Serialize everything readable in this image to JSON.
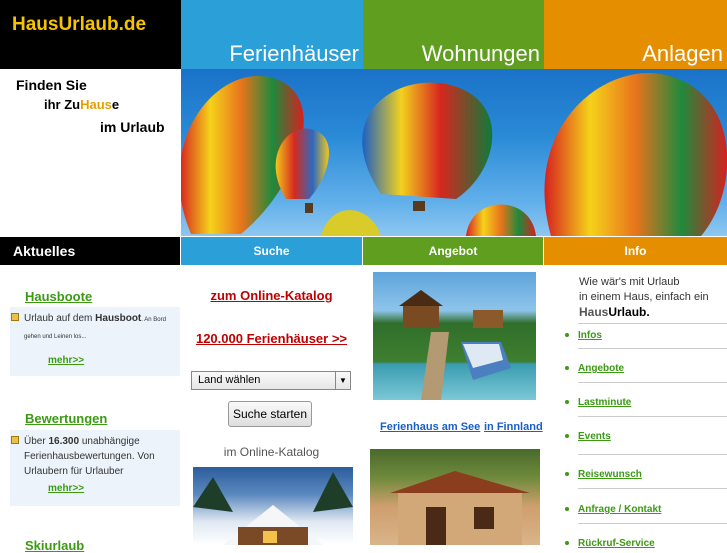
{
  "header": {
    "logo": "HausUrlaub.de",
    "nav": [
      "Ferienhäuser",
      "Wohnungen",
      "Anlagen"
    ]
  },
  "tagline": {
    "line1": "Finden Sie",
    "line2_pre": "ihr ",
    "line2_zu": "Zu",
    "line2_haus": "Haus",
    "line2_e": "e",
    "line3": "im Urlaub"
  },
  "sections": [
    "Aktuelles",
    "Suche",
    "Angebot",
    "Info"
  ],
  "aktuelles": {
    "hausboote_title": "Hausboote",
    "hausboote_pre": "Urlaub auf dem ",
    "hausboote_bold": "Hausboot",
    "hausboote_small": ". An Bord gehen und Leinen los...",
    "hausboote_more": "mehr>>",
    "bewertungen_title": "Bewertungen",
    "bew_pre": "Über ",
    "bew_bold": "16.300",
    "bew_rest": " unabhängige Ferienhausbewertungen. Von Urlaubern für Urlauber",
    "bew_more": "mehr>>",
    "third_title": "Skiurlaub"
  },
  "suche": {
    "catalog_link": "zum Online-Katalog",
    "count_link": "120.000 Ferienhäuser >>",
    "select_value": "Land wählen",
    "button": "Suche starten",
    "label": "im Online-Katalog"
  },
  "angebot": {
    "caption_a": "Ferienhaus am See",
    "caption_b": "in Finnland"
  },
  "info": {
    "text1": "Wie wär's mit Urlaub",
    "text2": "in einem Haus, einfach ein",
    "brand_a": "Haus",
    "brand_b": "Urlaub.",
    "items": [
      "Infos",
      "Angebote",
      "Lastminute",
      "Events",
      "Reisewunsch",
      "Anfrage / Kontakt",
      "Rückruf-Service"
    ]
  },
  "colors": {
    "blue": "#2a9fd8",
    "green": "#5f9e1e",
    "orange": "#e58f00",
    "logo_yellow": "#f5c400"
  }
}
